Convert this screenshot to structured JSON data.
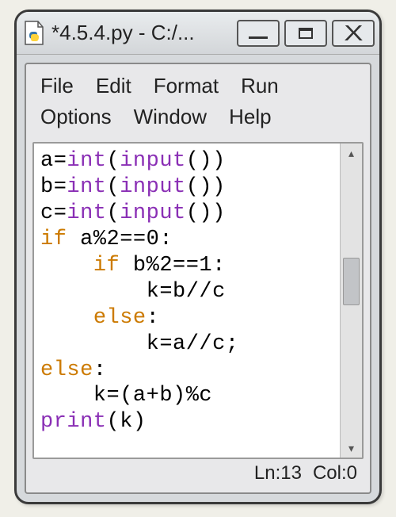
{
  "window": {
    "title": "*4.5.4.py - C:/..."
  },
  "menu": {
    "file": "File",
    "edit": "Edit",
    "format": "Format",
    "run": "Run",
    "options": "Options",
    "window": "Window",
    "help": "Help"
  },
  "code": {
    "lines": [
      {
        "indent": 0,
        "tokens": [
          {
            "t": "a=",
            "c": ""
          },
          {
            "t": "int",
            "c": "bi"
          },
          {
            "t": "(",
            "c": ""
          },
          {
            "t": "input",
            "c": "bi"
          },
          {
            "t": "())",
            "c": ""
          }
        ]
      },
      {
        "indent": 0,
        "tokens": [
          {
            "t": "b=",
            "c": ""
          },
          {
            "t": "int",
            "c": "bi"
          },
          {
            "t": "(",
            "c": ""
          },
          {
            "t": "input",
            "c": "bi"
          },
          {
            "t": "())",
            "c": ""
          }
        ]
      },
      {
        "indent": 0,
        "tokens": [
          {
            "t": "c=",
            "c": ""
          },
          {
            "t": "int",
            "c": "bi"
          },
          {
            "t": "(",
            "c": ""
          },
          {
            "t": "input",
            "c": "bi"
          },
          {
            "t": "())",
            "c": ""
          }
        ]
      },
      {
        "indent": 0,
        "tokens": [
          {
            "t": "if",
            "c": "kw"
          },
          {
            "t": " a%2==0:",
            "c": ""
          }
        ]
      },
      {
        "indent": 1,
        "tokens": [
          {
            "t": "if",
            "c": "kw"
          },
          {
            "t": " b%2==1:",
            "c": ""
          }
        ]
      },
      {
        "indent": 2,
        "tokens": [
          {
            "t": "k=b//c",
            "c": ""
          }
        ]
      },
      {
        "indent": 1,
        "tokens": [
          {
            "t": "else",
            "c": "kw"
          },
          {
            "t": ":",
            "c": ""
          }
        ]
      },
      {
        "indent": 2,
        "tokens": [
          {
            "t": "k=a//c;",
            "c": ""
          }
        ]
      },
      {
        "indent": 0,
        "tokens": [
          {
            "t": "else",
            "c": "kw"
          },
          {
            "t": ":",
            "c": ""
          }
        ]
      },
      {
        "indent": 1,
        "tokens": [
          {
            "t": "k=(a+b)%c",
            "c": ""
          }
        ]
      },
      {
        "indent": 0,
        "tokens": [
          {
            "t": "print",
            "c": "bi"
          },
          {
            "t": "(k)",
            "c": ""
          }
        ]
      }
    ]
  },
  "status": {
    "ln": "Ln:13",
    "col": "Col:0"
  }
}
